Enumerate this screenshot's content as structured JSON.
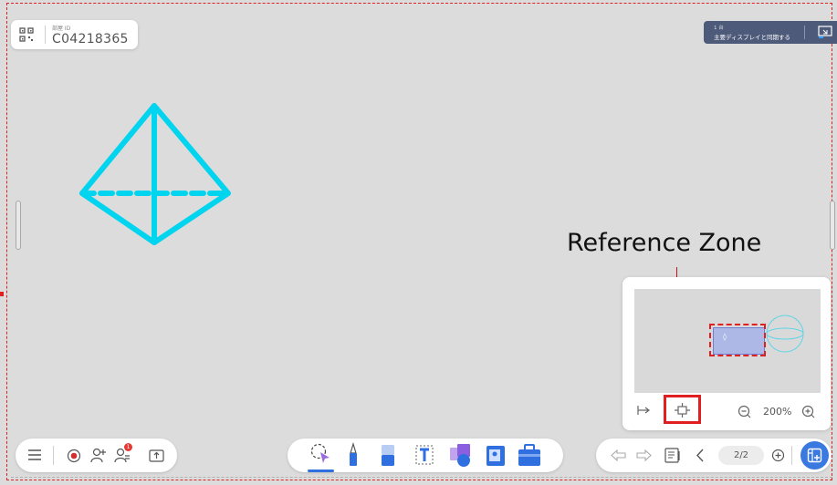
{
  "room": {
    "label": "部屋 ID",
    "id": "C04218365"
  },
  "mirror": {
    "count": "1 台",
    "label": "主要ディスプレイと同期する"
  },
  "annotation": {
    "reference_zone": "Reference Zone"
  },
  "minimap": {
    "zoom": "200%"
  },
  "bottom_right": {
    "page": "2/2"
  },
  "bottom_left": {
    "notification_count": "1"
  },
  "colors": {
    "accent": "#2f6fe0",
    "shape_cyan": "#00d4ee",
    "highlight_red": "#e02020",
    "mirror_bg": "#4d5a79"
  },
  "icons": {
    "top_left": "qr-code-icon",
    "top_right": "screen-mirror-icon",
    "bottom_left": [
      "menu-icon",
      "record-icon",
      "add-participant-icon",
      "participants-list-icon",
      "share-icon"
    ],
    "bottom_center": [
      "select-tool-icon",
      "pen-tool-icon",
      "eraser-tool-icon",
      "text-tool-icon",
      "shape-tool-icon",
      "image-tool-icon",
      "toolbox-icon"
    ],
    "bottom_right": [
      "undo-icon",
      "redo-icon",
      "page-list-icon",
      "previous-page-icon",
      "add-page-icon",
      "add-board-icon"
    ],
    "minimap": [
      "fit-width-icon",
      "center-view-icon",
      "zoom-out-icon",
      "zoom-in-icon"
    ]
  }
}
